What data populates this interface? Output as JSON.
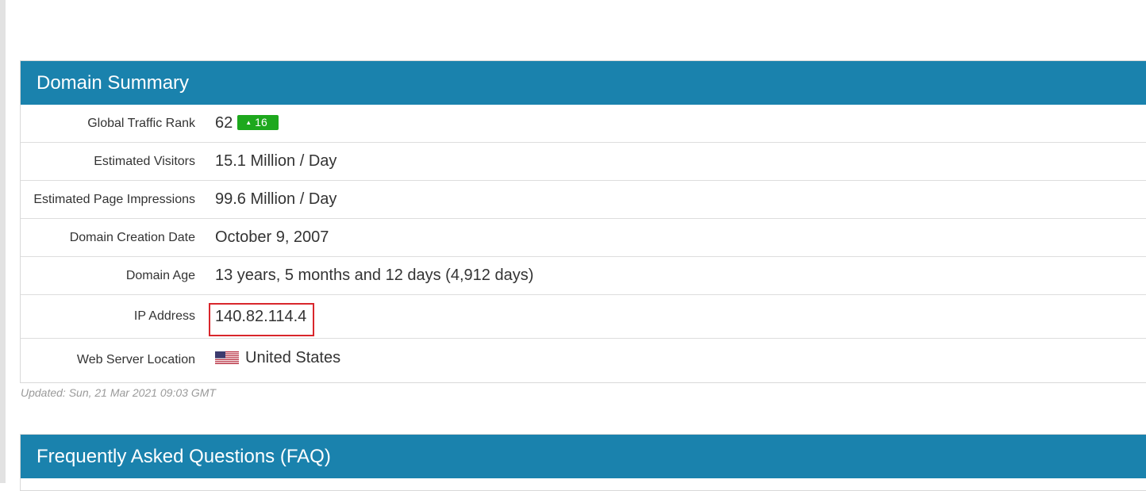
{
  "summary": {
    "title": "Domain Summary",
    "rows": [
      {
        "label": "Global Traffic Rank",
        "value": "62",
        "badge": "16"
      },
      {
        "label": "Estimated Visitors",
        "value": "15.1 Million / Day"
      },
      {
        "label": "Estimated Page Impressions",
        "value": "99.6 Million / Day"
      },
      {
        "label": "Domain Creation Date",
        "value": "October 9, 2007"
      },
      {
        "label": "Domain Age",
        "value": "13 years, 5 months and 12 days (4,912 days)"
      },
      {
        "label": "IP Address",
        "value": "140.82.114.4"
      },
      {
        "label": "Web Server Location",
        "value": "United States",
        "icon": "us-flag-icon"
      }
    ],
    "updated": "Updated: Sun, 21 Mar 2021 09:03 GMT"
  },
  "faq": {
    "title": "Frequently Asked Questions (FAQ)"
  },
  "colors": {
    "header_bg": "#1a82ad",
    "badge_bg": "#1da81d",
    "highlight_border": "#d9262c"
  }
}
